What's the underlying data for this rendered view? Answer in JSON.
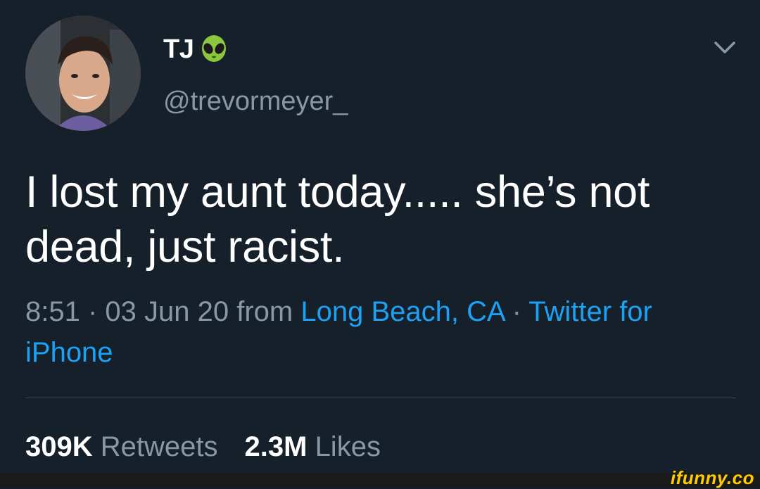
{
  "user": {
    "display_name": "TJ",
    "display_name_emoji_icon": "alien-icon",
    "handle": "@trevormeyer_",
    "avatar_icon": "avatar-photo"
  },
  "header": {
    "menu_icon": "chevron-down-icon"
  },
  "tweet": {
    "text": "I lost my aunt today..... she’s not dead, just racist."
  },
  "meta": {
    "time": "8:51",
    "separator1": " · ",
    "date": "03 Jun 20",
    "from_label": " from ",
    "location": "Long Beach, CA",
    "separator2": " · ",
    "source": "Twitter for iPhone"
  },
  "stats": {
    "retweets_count": "309K",
    "retweets_label": "Retweets",
    "likes_count": "2.3M",
    "likes_label": "Likes"
  },
  "watermark": {
    "text": "ifunny.co"
  },
  "colors": {
    "background": "#15202b",
    "primary_text": "#ffffff",
    "secondary_text": "#8899a6",
    "link": "#1da1f2",
    "divider": "#38444d",
    "watermark": "#ffcc00"
  }
}
